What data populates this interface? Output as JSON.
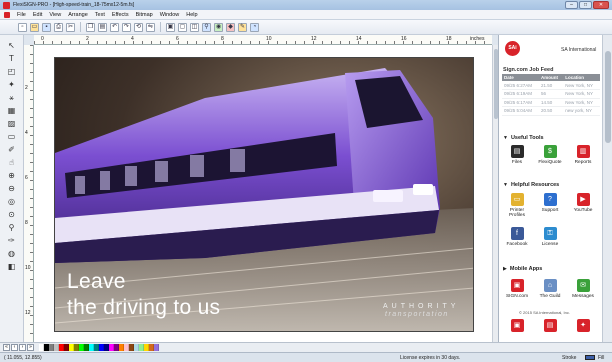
{
  "window": {
    "title": "FlexiSIGN-PRO - [High-speed-train_18-75mx12-5m.fs]",
    "controls": [
      "–",
      "□",
      "✕"
    ]
  },
  "menu": [
    "File",
    "Edit",
    "View",
    "Arrange",
    "Text",
    "Effects",
    "Bitmap",
    "Window",
    "Help"
  ],
  "toolbar_icons": [
    "new-icon",
    "open-icon",
    "save-icon",
    "print-icon",
    "cut-icon",
    "copy-icon",
    "paste-icon",
    "undo-icon",
    "redo-icon",
    "zoom-icon",
    "color-icon",
    "fill-icon"
  ],
  "ruler_top": {
    "labels": [
      "0",
      "2",
      "4",
      "6",
      "8",
      "10",
      "12",
      "14",
      "16",
      "18"
    ],
    "unit": "inches"
  },
  "ruler_left": {
    "labels": [
      "2",
      "4",
      "6",
      "8",
      "10",
      "12"
    ]
  },
  "tools": [
    "pointer-tool",
    "text-tool",
    "shape-tool",
    "node-tool",
    "knife-tool",
    "eraser-tool",
    "fill-tool",
    "pen-tool",
    "zoom-tool",
    "pan-tool"
  ],
  "artwork": {
    "headline_line1": "Leave",
    "headline_line2": "the driving to us",
    "brand_line1": "AUTHORITY",
    "brand_line2": "transportation"
  },
  "panel": {
    "logo_text": "SAi",
    "company": "SA International",
    "feed": {
      "title": "Sign.com Job Feed",
      "columns": [
        "Date",
        "Amount",
        "Location"
      ],
      "rows": [
        [
          "09/25 6:27AM",
          "21.50",
          "New York, NY"
        ],
        [
          "09/25 6:19AM",
          "56",
          "New York, NY"
        ],
        [
          "09/25 6:17AM",
          "14.50",
          "New York, NY"
        ],
        [
          "09/25 5:04AM",
          "20.50",
          "new york, NY"
        ]
      ]
    },
    "useful_tools": {
      "title": "Useful Tools",
      "items": [
        {
          "label": "Files",
          "icon": "files-icon",
          "color": "#2b2b2b"
        },
        {
          "label": "FlexiQuote",
          "icon": "flexiquote-icon",
          "color": "#3aa13a"
        },
        {
          "label": "Reports",
          "icon": "reports-icon",
          "color": "#d8232a"
        }
      ]
    },
    "helpful_resources": {
      "title": "Helpful Resources",
      "items": [
        {
          "label": "Printer Profiles",
          "icon": "printer-profiles-icon",
          "color": "#e3b230"
        },
        {
          "label": "Support",
          "icon": "support-icon",
          "color": "#2d6fcf"
        },
        {
          "label": "YouTube",
          "icon": "youtube-icon",
          "color": "#d8232a"
        },
        {
          "label": "Facebook",
          "icon": "facebook-icon",
          "color": "#3b5998"
        },
        {
          "label": "License",
          "icon": "license-icon",
          "color": "#2d8ccf"
        }
      ]
    },
    "mobile_apps": {
      "title": "Mobile Apps",
      "items": [
        {
          "label": "SIGN.com",
          "icon": "signcom-icon",
          "color": "#d8232a"
        },
        {
          "label": "The Guild",
          "icon": "guild-icon",
          "color": "#6a8fc4"
        },
        {
          "label": "Messages",
          "icon": "messages-icon",
          "color": "#3aa13a"
        }
      ],
      "footer": "© 2015 SA International, Inc."
    }
  },
  "palette_colors": [
    "#ffffff",
    "#000000",
    "#7f7f7f",
    "#c0c0c0",
    "#ff0000",
    "#800000",
    "#ffff00",
    "#808000",
    "#00ff00",
    "#008000",
    "#00ffff",
    "#008080",
    "#0000ff",
    "#000080",
    "#ff00ff",
    "#800080",
    "#ff8000",
    "#ffc0cb",
    "#8b4513",
    "#add8e6",
    "#90ee90",
    "#ffd700",
    "#d2691e",
    "#9370db"
  ],
  "status": {
    "coords": "( 11.055,  12.855)",
    "license": "License expires in 30 days.",
    "stroke_label": "Stroke",
    "fill_label": "Fill"
  }
}
